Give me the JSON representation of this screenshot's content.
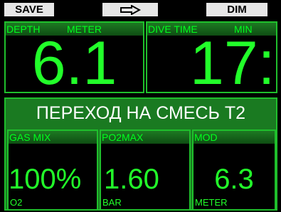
{
  "softkeys": {
    "left": "SAVE",
    "middle_icon": "arrow-right-icon",
    "right": "DIM"
  },
  "depth": {
    "label": "DEPTH",
    "unit": "METER",
    "value": "6.1"
  },
  "dive_time": {
    "label": "DIVE TIME",
    "unit": "MIN",
    "value": "17:"
  },
  "gas_switch": {
    "title": "ПЕРЕХОД НА СМЕСЬ T2",
    "gas_mix": {
      "label": "GAS MIX",
      "value": "100%",
      "unit": "O2"
    },
    "po2max": {
      "label": "PO2MAX",
      "value": "1.60",
      "unit": "BAR"
    },
    "mod": {
      "label": "MOD",
      "value": "6.3",
      "unit": "METER"
    }
  },
  "colors": {
    "accent_green": "#22ff2a",
    "panel_border": "#1fbf2c",
    "switch_bg": "#1a7a21"
  }
}
